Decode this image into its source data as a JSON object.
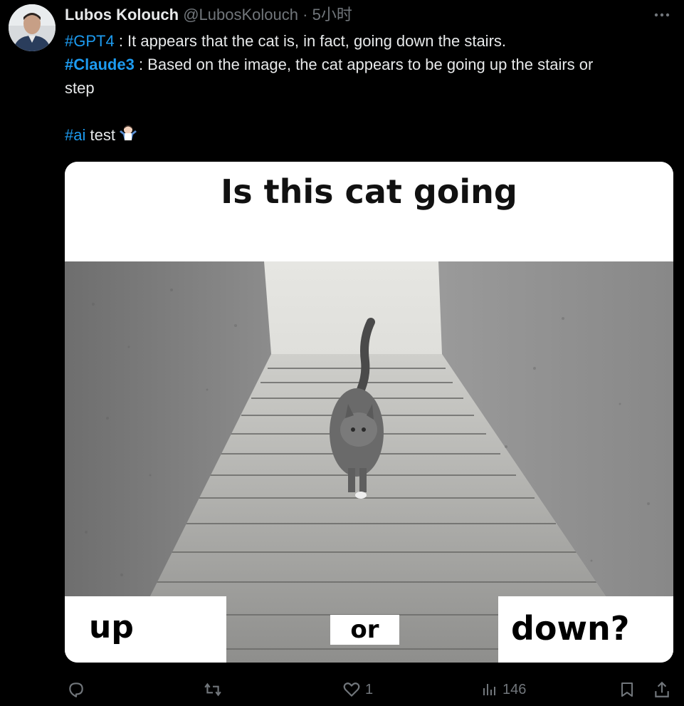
{
  "author": {
    "name": "Lubos Kolouch",
    "handle": "@LubosKolouch",
    "separator": "·",
    "time": "5小时"
  },
  "tweet": {
    "hashtag_gpt4": "#GPT4",
    "gpt4_text": " : It appears that the cat is, in fact, going down the stairs.",
    "hashtag_claude3": "#Claude3",
    "claude3_text_line1": " : Based on the image, the cat appears to be going up the stairs or",
    "claude3_text_line2": "step",
    "hashtag_ai": "#ai",
    "ai_text": " test",
    "emoji": "person-shrugging-emoji"
  },
  "media": {
    "title": "Is this cat going",
    "label_up": "up",
    "label_or": "or",
    "label_down": "down?"
  },
  "actions": {
    "reply_icon": "reply-icon",
    "retweet_icon": "retweet-icon",
    "like_icon": "heart-icon",
    "like_count": "1",
    "views_icon": "analytics-icon",
    "views_count": "146",
    "bookmark_icon": "bookmark-icon",
    "share_icon": "share-icon"
  },
  "colors": {
    "background": "#000000",
    "text": "#e7e9ea",
    "muted": "#71767b",
    "link": "#1d9bf0"
  }
}
